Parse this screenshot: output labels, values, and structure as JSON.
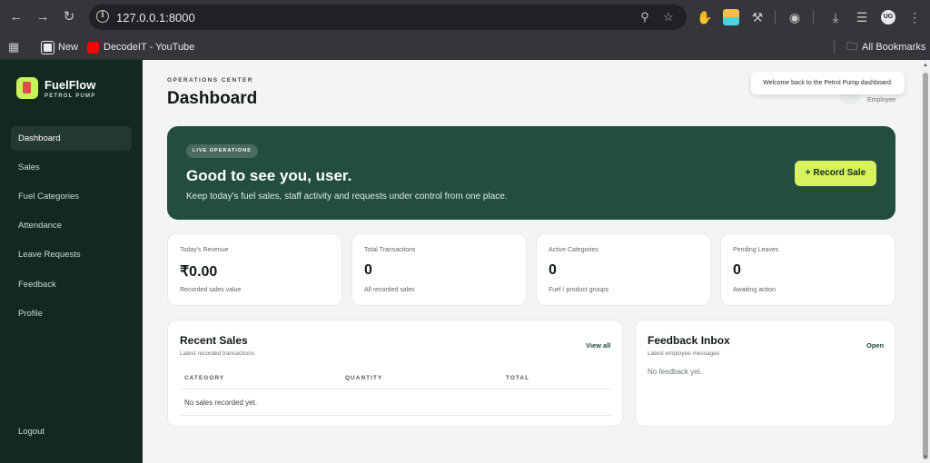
{
  "browser": {
    "url": "127.0.0.1:8000",
    "bookmarks": [
      {
        "label": "New",
        "icon": "bookmark-favicon-icon"
      },
      {
        "label": "DecodeIT - YouTube",
        "icon": "youtube-icon"
      }
    ],
    "all_bookmarks_label": "All Bookmarks",
    "profile_initials": "UG"
  },
  "sidebar": {
    "brand_name": "FuelFlow",
    "brand_subtitle": "PETROL PUMP",
    "items": [
      {
        "label": "Dashboard",
        "active": true
      },
      {
        "label": "Sales"
      },
      {
        "label": "Fuel Categories"
      },
      {
        "label": "Attendance"
      },
      {
        "label": "Leave Requests"
      },
      {
        "label": "Feedback"
      },
      {
        "label": "Profile"
      }
    ],
    "logout_label": "Logout"
  },
  "header": {
    "eyebrow": "OPERATIONS CENTER",
    "title": "Dashboard",
    "toast": "Welcome back to the Petrol Pump dashboard.",
    "user_role": "Employee"
  },
  "hero": {
    "pill": "LIVE OPERATIONS",
    "title": "Good to see you, user.",
    "description": "Keep today's fuel sales, staff activity and requests under control from one place.",
    "button_label": "+ Record Sale"
  },
  "stats": [
    {
      "label": "Today's Revenue",
      "value": "₹0.00",
      "caption": "Recorded sales value"
    },
    {
      "label": "Total Transactions",
      "value": "0",
      "caption": "All recorded sales"
    },
    {
      "label": "Active Categories",
      "value": "0",
      "caption": "Fuel / product groups"
    },
    {
      "label": "Pending Leaves",
      "value": "0",
      "caption": "Awaiting action"
    }
  ],
  "recent_sales": {
    "title": "Recent Sales",
    "subtitle": "Latest recorded transactions",
    "link": "View all",
    "columns": [
      "CATEGORY",
      "QUANTITY",
      "TOTAL"
    ],
    "empty": "No sales recorded yet."
  },
  "feedback": {
    "title": "Feedback Inbox",
    "subtitle": "Latest employee messages",
    "link": "Open",
    "empty": "No feedback yet."
  },
  "colors": {
    "sidebar": "#12291f",
    "hero": "#234e3f",
    "accent": "#d7f25c",
    "page_bg": "#f4f5f3"
  }
}
